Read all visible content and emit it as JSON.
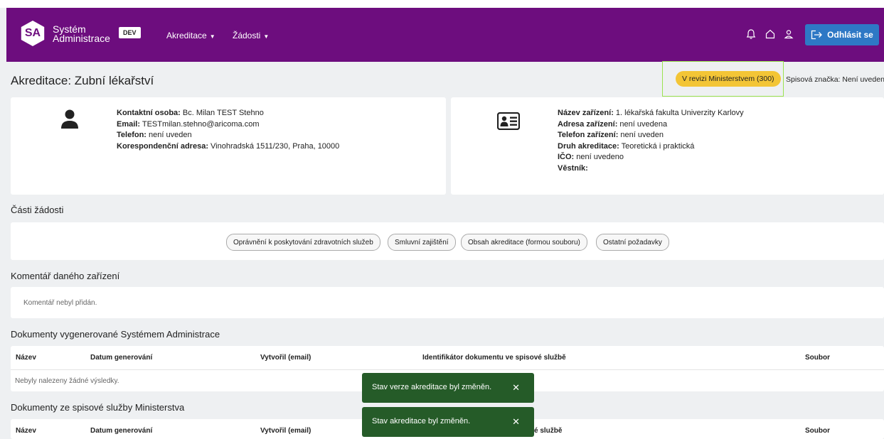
{
  "header": {
    "logo": "SA",
    "brand_line1": "Systém",
    "brand_line2": "Administrace",
    "env_badge": "DEV",
    "nav": [
      {
        "label": "Akreditace"
      },
      {
        "label": "Žádosti"
      }
    ],
    "logout_label": "Odhlásit se"
  },
  "page": {
    "title": "Akreditace: Zubní lékařství",
    "status": "V revizi Ministerstvem (300)",
    "spis_label": "Spisová značka: Není uvedena"
  },
  "contact": {
    "lines": [
      {
        "label": "Kontaktní osoba:",
        "value": " Bc. Milan TEST Stehno"
      },
      {
        "label": "Email:",
        "value": " TESTmilan.stehno@aricoma.com"
      },
      {
        "label": "Telefon:",
        "value": " není uveden"
      },
      {
        "label": "Korespondenční adresa:",
        "value": " Vinohradská 1511/230, Praha, 10000"
      }
    ]
  },
  "facility": {
    "lines": [
      {
        "label": "Název zařízení:",
        "value": " 1. lékařská fakulta Univerzity Karlovy"
      },
      {
        "label": "Adresa zařízení:",
        "value": " není uvedena"
      },
      {
        "label": "Telefon zařízení:",
        "value": " není uveden"
      },
      {
        "label": "Druh akreditace:",
        "value": " Teoretická i praktická"
      },
      {
        "label": "IČO:",
        "value": " není uvedeno"
      },
      {
        "label": "Věstník:",
        "value": ""
      }
    ]
  },
  "parts": {
    "title": "Části žádosti",
    "chips": [
      "Oprávnění k poskytování zdravotních služeb",
      "Smluvní zajištění",
      "Obsah akreditace (formou souboru)",
      "Ostatní požadavky"
    ]
  },
  "comment": {
    "title": "Komentář daného zařízení",
    "text": "Komentář nebyl přidán."
  },
  "docs_generated": {
    "title": "Dokumenty vygenerované Systémem Administrace",
    "columns": [
      "Název",
      "Datum generování",
      "Vytvořil (email)",
      "Identifikátor dokumentu ve spisové službě",
      "Soubor"
    ],
    "empty": "Nebyly nalezeny žádné výsledky."
  },
  "docs_ministry": {
    "title": "Dokumenty ze spisové služby Ministerstva",
    "columns": [
      "Název",
      "Datum generování",
      "Vytvořil (email)",
      "é službě",
      "Soubor"
    ]
  },
  "toasts": [
    {
      "text": "Stav verze akreditace byl změněn."
    },
    {
      "text": "Stav akreditace byl změněn."
    }
  ],
  "colors": {
    "navbar": "#6d0d7e",
    "logout": "#2e78c5",
    "status": "#f3c536",
    "toast": "#255b28",
    "highlight": "#9be34f"
  },
  "icons": {
    "notifications": "bell-icon",
    "home": "home-icon",
    "user": "user-icon",
    "logout": "logout-icon",
    "contact": "person-icon",
    "facility": "id-card-icon",
    "toast_close": "close-icon"
  }
}
